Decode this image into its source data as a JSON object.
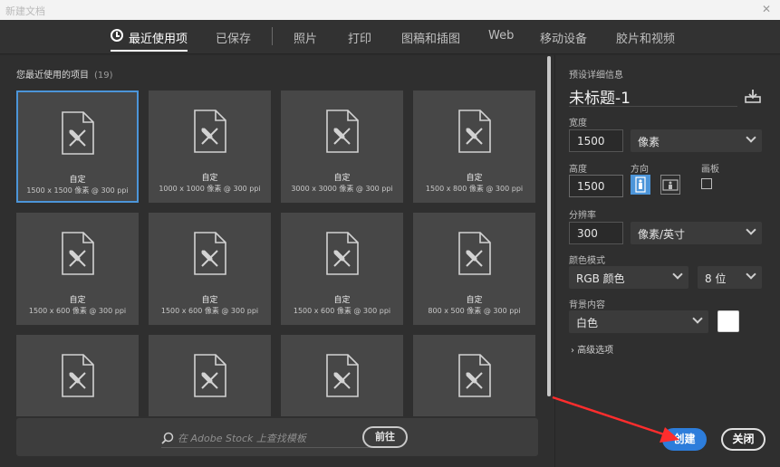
{
  "window": {
    "title": "新建文档",
    "close_glyph": "✕"
  },
  "tabs": [
    {
      "label": "最近使用项",
      "active": true
    },
    {
      "label": "已保存"
    },
    {
      "label": "照片"
    },
    {
      "label": "打印"
    },
    {
      "label": "图稿和插图"
    },
    {
      "label": "Web"
    },
    {
      "label": "移动设备"
    },
    {
      "label": "胶片和视频"
    }
  ],
  "recent": {
    "title": "您最近使用的项目",
    "count": "(19)",
    "items": [
      {
        "name": "自定",
        "dims": "1500 x 1500 像素 @ 300 ppi"
      },
      {
        "name": "自定",
        "dims": "1000 x 1000 像素 @ 300 ppi"
      },
      {
        "name": "自定",
        "dims": "3000 x 3000 像素 @ 300 ppi"
      },
      {
        "name": "自定",
        "dims": "1500 x 800 像素 @ 300 ppi"
      },
      {
        "name": "自定",
        "dims": "1500 x 600 像素 @ 300 ppi"
      },
      {
        "name": "自定",
        "dims": "1500 x 600 像素 @ 300 ppi"
      },
      {
        "name": "自定",
        "dims": "1500 x 600 像素 @ 300 ppi"
      },
      {
        "name": "自定",
        "dims": "800 x 500 像素 @ 300 ppi"
      }
    ]
  },
  "stock": {
    "placeholder": "在 Adobe Stock 上查找模板",
    "go_label": "前往"
  },
  "details": {
    "section_label": "预设详细信息",
    "doc_name": "未标题-1",
    "width_label": "宽度",
    "width_value": "1500",
    "width_unit": "像素",
    "height_label": "高度",
    "height_value": "1500",
    "orientation_label": "方向",
    "artboard_label": "画板",
    "resolution_label": "分辨率",
    "resolution_value": "300",
    "resolution_unit": "像素/英寸",
    "color_mode_label": "颜色模式",
    "color_mode_value": "RGB 颜色",
    "bit_depth_value": "8 位",
    "background_label": "背景内容",
    "background_value": "白色",
    "advanced_label": "高级选项"
  },
  "actions": {
    "create_label": "创建",
    "close_label": "关闭"
  },
  "colors": {
    "accent": "#2d7ddb",
    "selected_border": "#4c95d9",
    "annotation_arrow": "#ff2d2d"
  }
}
